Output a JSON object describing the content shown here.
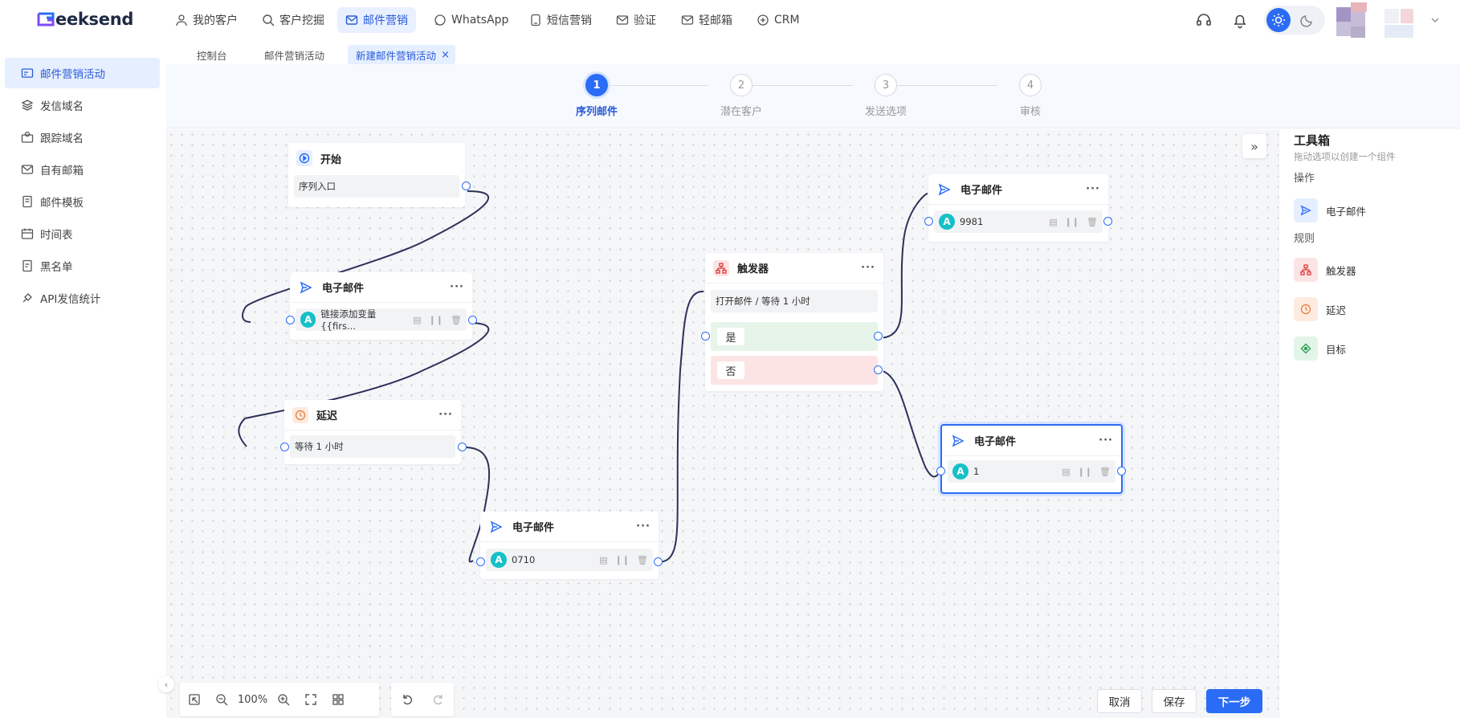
{
  "app": {
    "logo": "Geeksend",
    "logo_mark": "G",
    "logo_rest": "eeksend"
  },
  "nav": [
    {
      "label": "我的客户",
      "icon": "user-icon"
    },
    {
      "label": "客户挖掘",
      "icon": "search-icon"
    },
    {
      "label": "邮件营销",
      "icon": "mail-icon"
    },
    {
      "label": "WhatsApp",
      "icon": "whatsapp-icon"
    },
    {
      "label": "短信营销",
      "icon": "sms-icon"
    },
    {
      "label": "验证",
      "icon": "verify-icon"
    },
    {
      "label": "轻邮箱",
      "icon": "light-mail-icon"
    },
    {
      "label": "CRM",
      "icon": "crm-icon"
    }
  ],
  "tabs": [
    "控制台",
    "邮件营销活动",
    "新建邮件营销活动"
  ],
  "sidebar": [
    {
      "label": "邮件营销活动",
      "icon": "campaign-icon"
    },
    {
      "label": "发信域名",
      "icon": "domain-icon"
    },
    {
      "label": "跟踪域名",
      "icon": "tracking-icon"
    },
    {
      "label": "自有邮箱",
      "icon": "mailbox-icon"
    },
    {
      "label": "邮件模板",
      "icon": "template-icon"
    },
    {
      "label": "时间表",
      "icon": "schedule-icon"
    },
    {
      "label": "黑名单",
      "icon": "blacklist-icon"
    },
    {
      "label": "API发信统计",
      "icon": "api-icon"
    }
  ],
  "steps": [
    {
      "num": "1",
      "label": "序列邮件"
    },
    {
      "num": "2",
      "label": "潜在客户"
    },
    {
      "num": "3",
      "label": "发送选项"
    },
    {
      "num": "4",
      "label": "审核"
    }
  ],
  "nodes": {
    "start": {
      "title": "开始",
      "body": "序列入口"
    },
    "email1": {
      "title": "电子邮件",
      "badge": "A",
      "body": "链接添加变量{{firs..."
    },
    "delay": {
      "title": "延迟",
      "body": "等待 1 小时"
    },
    "email2": {
      "title": "电子邮件",
      "badge": "A",
      "body": "0710"
    },
    "trigger": {
      "title": "触发器",
      "body": "打开邮件 / 等待 1 小时",
      "yes": "是",
      "no": "否"
    },
    "email3": {
      "title": "电子邮件",
      "badge": "A",
      "body": "9981"
    },
    "email4": {
      "title": "电子邮件",
      "badge": "A",
      "body": "1"
    },
    "more": "···"
  },
  "toolbox": {
    "title": "工具箱",
    "subtitle": "拖动选项以创建一个组件",
    "sec_ops": "操作",
    "sec_rules": "规则",
    "items": {
      "email": "电子邮件",
      "trigger": "触发器",
      "delay": "延迟",
      "goal": "目标"
    }
  },
  "zoom": "100%",
  "buttons": {
    "cancel": "取消",
    "save": "保存",
    "next": "下一步"
  },
  "colors": {
    "accent": "#2b6cf6",
    "edge": "#2c3159",
    "yes": "#e6f4ea",
    "no": "#fde4e4"
  }
}
